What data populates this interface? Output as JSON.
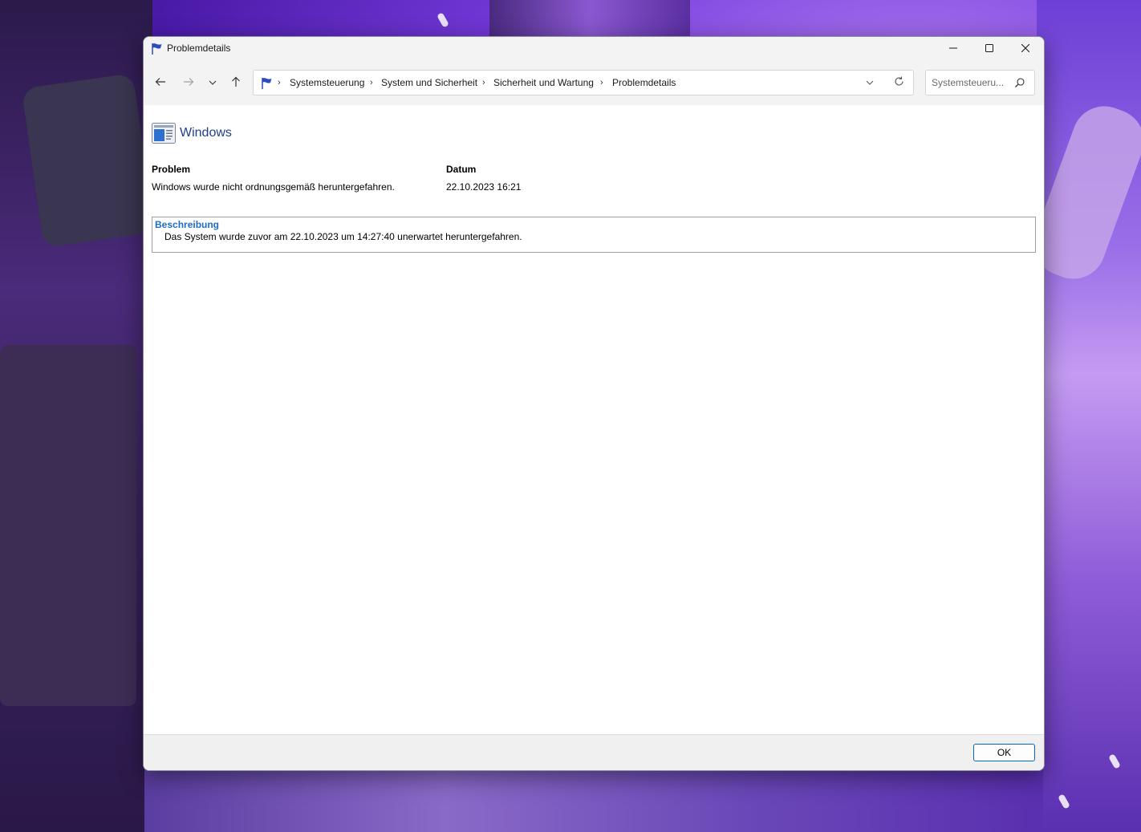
{
  "window": {
    "title": "Problemdetails"
  },
  "titlebar_buttons": {
    "minimize_icon": "minimize-icon",
    "maximize_icon": "maximize-icon",
    "close_icon": "close-icon"
  },
  "nav": {
    "back_icon": "arrow-left-icon",
    "forward_icon": "arrow-right-icon",
    "recent_icon": "chevron-down-icon",
    "up_icon": "arrow-up-icon"
  },
  "breadcrumb": {
    "items": [
      {
        "label": "Systemsteuerung"
      },
      {
        "label": "System und Sicherheit"
      },
      {
        "label": "Sicherheit und Wartung"
      },
      {
        "label": "Problemdetails"
      }
    ]
  },
  "search": {
    "placeholder": "Systemsteueru..."
  },
  "app": {
    "name": "Windows"
  },
  "problem": {
    "label": "Problem",
    "value": "Windows wurde nicht ordnungsgemäß heruntergefahren."
  },
  "date": {
    "label": "Datum",
    "value": "22.10.2023 16:21"
  },
  "description": {
    "title": "Beschreibung",
    "text": "Das System wurde zuvor am 22.10.2023 um 14:27:40 unerwartet heruntergefahren."
  },
  "footer": {
    "ok_label": "OK"
  },
  "colors": {
    "accent": "#0067c0",
    "title_blue": "#1e3f8a",
    "desc_title": "#1f6cc6",
    "flag": "#2c4bbf"
  }
}
